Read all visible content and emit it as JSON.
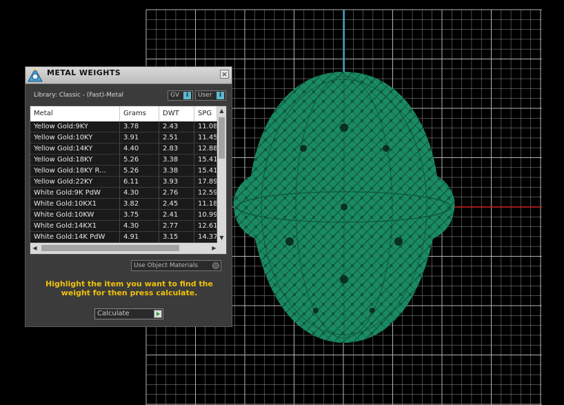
{
  "window": {
    "title": "METAL WEIGHTS",
    "close_glyph": "×"
  },
  "library": {
    "label": "Library: Classic - (Fast)-Metal"
  },
  "segments": {
    "gv_label": "GV",
    "user_label": "User",
    "info_glyph": "i"
  },
  "table": {
    "headers": [
      "Metal",
      "Grams",
      "DWT",
      "SPG"
    ],
    "rows": [
      [
        "Yellow Gold:9KY",
        "3.78",
        "2.43",
        "11.08"
      ],
      [
        "Yellow Gold:10KY",
        "3.91",
        "2.51",
        "11.45"
      ],
      [
        "Yellow Gold:14KY",
        "4.40",
        "2.83",
        "12.88"
      ],
      [
        "Yellow Gold:18KY",
        "5.26",
        "3.38",
        "15.41"
      ],
      [
        "Yellow Gold:18KY R...",
        "5.26",
        "3.38",
        "15.41"
      ],
      [
        "Yellow Gold:22KY",
        "6.11",
        "3.93",
        "17.89"
      ],
      [
        "White Gold:9K PdW",
        "4.30",
        "2.76",
        "12.59"
      ],
      [
        "White Gold:10KX1",
        "3.82",
        "2.45",
        "11.18"
      ],
      [
        "White Gold:10KW",
        "3.75",
        "2.41",
        "10.99"
      ],
      [
        "White Gold:14KX1",
        "4.30",
        "2.77",
        "12.61"
      ],
      [
        "White Gold:14K PdW",
        "4.91",
        "3.15",
        "14.37"
      ]
    ]
  },
  "use_object_materials": {
    "label": "Use Object Materials"
  },
  "hint": {
    "text": "Highlight the item you want to find the weight for then press calculate."
  },
  "calculate": {
    "label": "Calculate"
  },
  "viewport": {
    "object_color": "#1a8a62",
    "grid_color": "#bdbdbd",
    "axis_y_color": "#2ea6c4",
    "axis_x_color": "#d32020"
  }
}
